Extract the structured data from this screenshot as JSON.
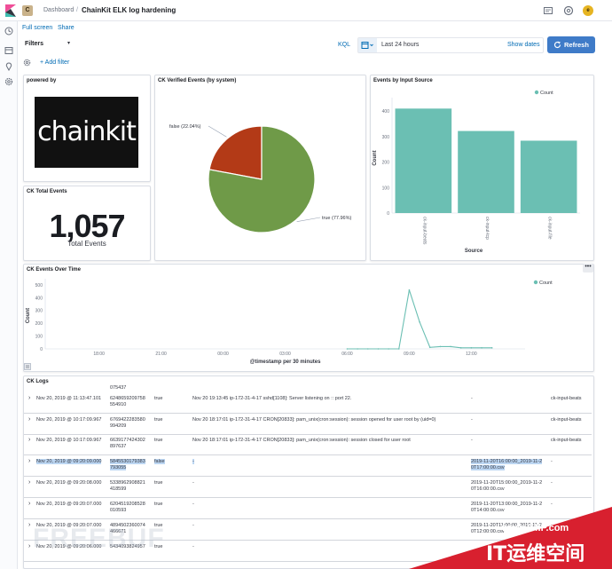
{
  "header": {
    "app_badge": "C",
    "breadcrumbs": [
      "Dashboard",
      "ChainKit ELK log hardening"
    ],
    "separator": "/",
    "avatar_initial": "e"
  },
  "links": {
    "full_screen": "Full screen",
    "share": "Share"
  },
  "filterbar": {
    "filters_label": "Filters",
    "kql_label": "KQL",
    "date_range": "Last 24 hours",
    "show_dates": "Show dates",
    "refresh_label": "Refresh",
    "add_filter": "+ Add filter"
  },
  "panels": {
    "powered_by": {
      "title": "powered by",
      "logo_text": "chainkit"
    },
    "total_events": {
      "title": "CK Total Events",
      "value": "1,057",
      "label": "Total Events"
    },
    "verified_events": {
      "title": "CK Verified Events (by system)"
    },
    "input_source": {
      "title": "Events by Input Source"
    },
    "events_over_time": {
      "title": "CK Events Over Time"
    },
    "logs": {
      "title": "CK Logs"
    }
  },
  "colors": {
    "accent": "#3f7bc8",
    "teal": "#6bbfb3",
    "green": "#6f9a48",
    "red": "#b33a17"
  },
  "chart_data": [
    {
      "type": "pie",
      "title": "CK Verified Events (by system)",
      "slices": [
        {
          "label": "false (22.04%)",
          "value": 22.04,
          "color": "#b33a17"
        },
        {
          "label": "true (77.96%)",
          "value": 77.96,
          "color": "#6f9a48"
        }
      ]
    },
    {
      "type": "bar",
      "title": "Events by Input Source",
      "categories": [
        "ck-input-beats",
        "ck-input-tcp",
        "ck-input-file"
      ],
      "values": [
        410,
        322,
        284
      ],
      "xlabel": "Source",
      "ylabel": "Count",
      "ylim": [
        0,
        400
      ],
      "yticks": [
        0,
        100,
        200,
        300,
        400
      ],
      "legend": "Count",
      "legend_position": "top-right",
      "color": "#6bbfb3"
    },
    {
      "type": "line",
      "title": "CK Events Over Time",
      "x": [
        6.0,
        6.5,
        7.0,
        7.5,
        8.0,
        8.5,
        9.0,
        9.5,
        10.0,
        10.5,
        11.0,
        11.5,
        12.0,
        12.5,
        13.0
      ],
      "values": [
        0,
        0,
        0,
        0,
        0,
        0,
        460,
        210,
        12,
        18,
        18,
        8,
        8,
        8,
        8
      ],
      "x_start": 6.0,
      "x_ticks": [
        "18:00",
        "21:00",
        "00:00",
        "03:00",
        "06:00",
        "09:00",
        "12:00"
      ],
      "xlabel": "@timestamp per 30 minutes",
      "ylabel": "Count",
      "ylim": [
        0,
        500
      ],
      "yticks": [
        0,
        100,
        200,
        300,
        400,
        500
      ],
      "legend": "Count",
      "legend_position": "top-right",
      "color": "#6bbfb3"
    }
  ],
  "logs": {
    "partial_top": "075437",
    "rows": [
      {
        "time": "Nov 20, 2019 @ 11:13:47.101",
        "id": "6248659209758\n554910",
        "verified": "true",
        "message": "Nov 20 19:13:45 ip-172-31-4-17 sshd[1108]: Server listening on :: port 22.",
        "file": "-",
        "source": "ck-input-beats"
      },
      {
        "time": "Nov 20, 2019 @ 10:17:09.967",
        "id": "6769422283580\n994209",
        "verified": "true",
        "message": "Nov 20 18:17:01 ip-172-31-4-17 CRON[20833]: pam_unix(cron:session): session opened for user root by (uid=0)",
        "file": "-",
        "source": "ck-input-beats"
      },
      {
        "time": "Nov 20, 2019 @ 10:17:09.967",
        "id": "6639177424302\n897637",
        "verified": "true",
        "message": "Nov 20 18:17:01 ip-172-31-4-17 CRON[20833]: pam_unix(cron:session): session closed for user root",
        "file": "-",
        "source": "ck-input-beats"
      },
      {
        "time": "Nov 20, 2019 @ 09:20:09.000",
        "id": "5845530179383\n793055",
        "verified": "false",
        "message": "-",
        "file": "2019-11-20T16:00:00_2019-11-2\n0T17:00:00.csv",
        "source": "-"
      },
      {
        "time": "Nov 20, 2019 @ 09:20:08.000",
        "id": "5338962908821\n418599",
        "verified": "true",
        "message": "-",
        "file": "2019-11-20T15:00:00_2019-11-2\n0T16:00:00.csv",
        "source": "-"
      },
      {
        "time": "Nov 20, 2019 @ 09:20:07.000",
        "id": "6204519208528\n010593",
        "verified": "true",
        "message": "-",
        "file": "2019-11-20T13:00:00_2019-11-2\n0T14:00:00.csv",
        "source": "-"
      },
      {
        "time": "Nov 20, 2019 @ 09:20:07.000",
        "id": "4894502360074\n466671",
        "verified": "true",
        "message": "-",
        "file": "2019-11-20T11:00:00_2019-11-2\n0T12:00:00.csv",
        "source": "-"
      },
      {
        "time": "Nov 20, 2019 @ 09:20:06.000",
        "id": "5434093824957",
        "verified": "true",
        "message": "-",
        "file": "",
        "source": "-"
      }
    ]
  },
  "watermark": {
    "url": "www.94IP.com",
    "cn": "IT运维空间",
    "faded": "FREEBUF"
  }
}
